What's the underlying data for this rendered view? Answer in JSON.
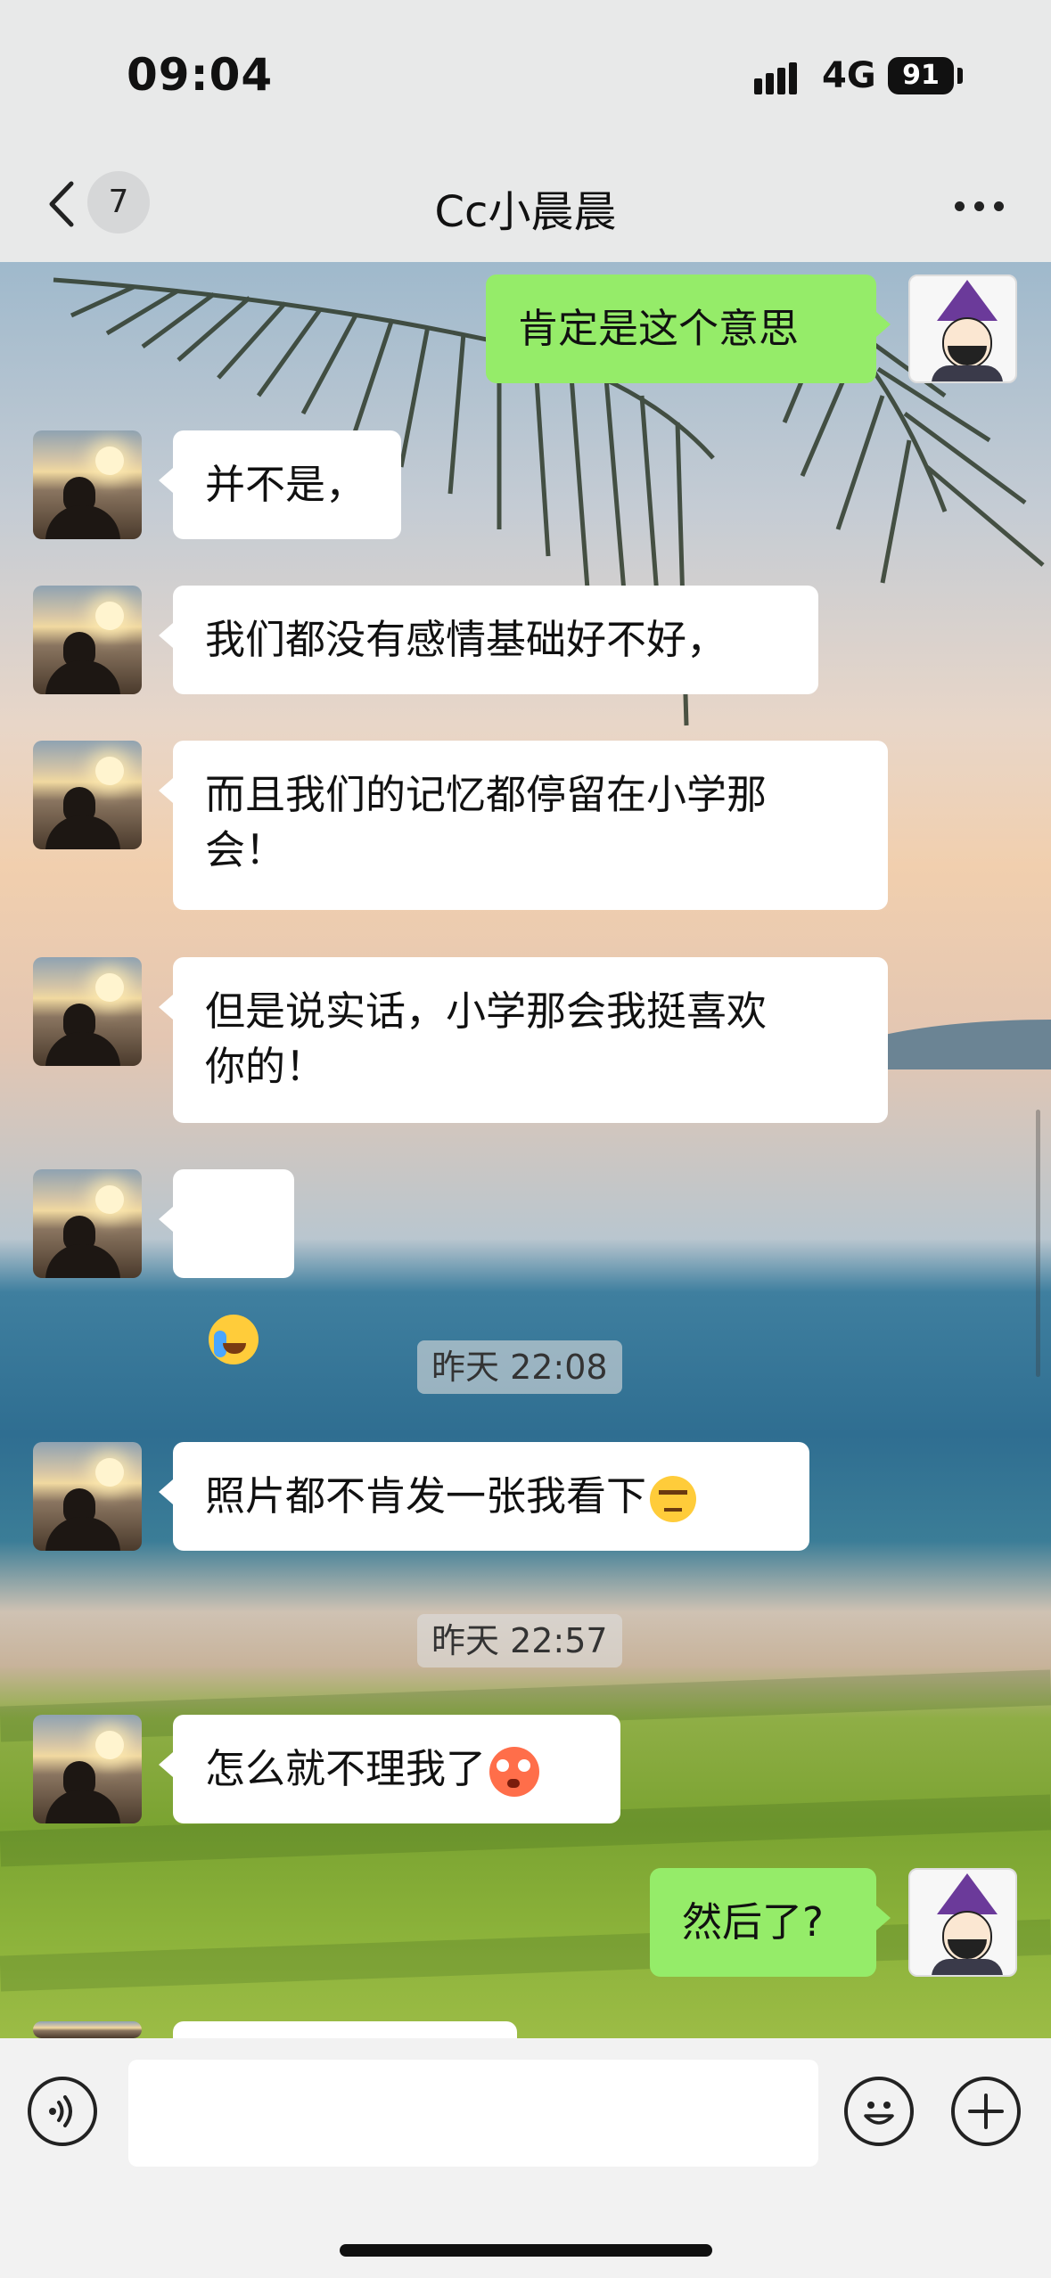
{
  "status_bar": {
    "time": "09:04",
    "network": "4G",
    "battery": "91"
  },
  "nav": {
    "unread_count": "7",
    "title": "Cc小晨晨",
    "back_icon": "chevron-left-icon",
    "more_icon": "more-dots-icon"
  },
  "messages": [
    {
      "side": "out",
      "text": "肯定是这个意思"
    },
    {
      "side": "in",
      "text": "并不是，"
    },
    {
      "side": "in",
      "text": "我们都没有感情基础好不好，"
    },
    {
      "side": "in",
      "text": "而且我们的记忆都停留在小学那\n会！"
    },
    {
      "side": "in",
      "text": "但是说实话，小学那会我挺喜欢\n你的！"
    },
    {
      "side": "in",
      "emoji": "loudly-crying-emoji"
    },
    {
      "type": "timestamp",
      "text": "昨天 22:08"
    },
    {
      "side": "in",
      "text": "照片都不肯发一张我看下",
      "emoji": "unamused-emoji"
    },
    {
      "type": "timestamp",
      "text": "昨天 22:57"
    },
    {
      "side": "in",
      "text": "怎么就不理我了",
      "emoji": "flushed-emoji"
    },
    {
      "side": "out",
      "text": "然后了?"
    }
  ],
  "input_bar": {
    "voice_icon": "voice-icon",
    "emoji_icon": "smiley-icon",
    "plus_icon": "plus-icon",
    "input_value": ""
  },
  "colors": {
    "outgoing_bubble": "#95ec69",
    "incoming_bubble": "#ffffff",
    "bar_background": "#e8e9e9"
  }
}
